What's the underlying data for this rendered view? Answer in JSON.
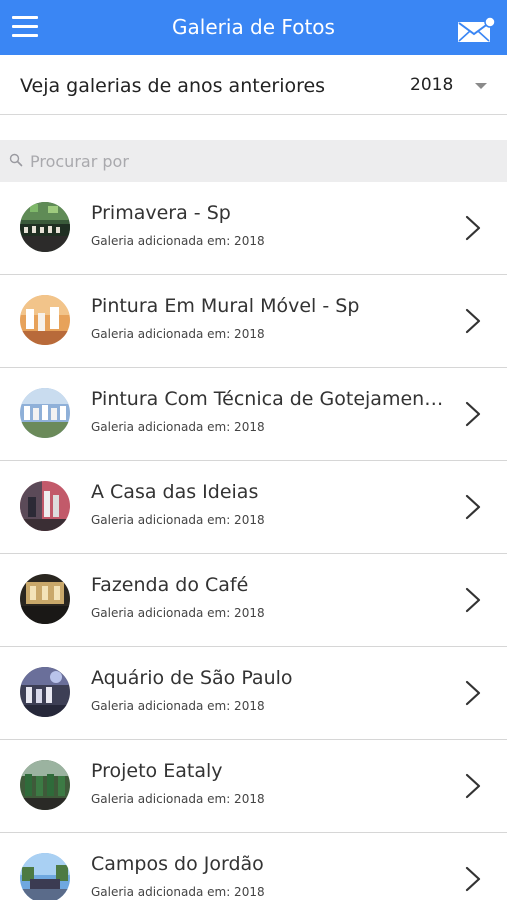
{
  "header": {
    "title": "Galeria de Fotos",
    "menu_icon": "hamburger-menu-icon",
    "mail_icon": "mail-notification-icon",
    "bg_color": "#3a86f4"
  },
  "year_selector": {
    "label": "Veja galerias de anos anteriores",
    "value": "2018",
    "caret_icon": "caret-down-icon"
  },
  "search": {
    "placeholder": "Procurar por",
    "icon": "search-icon"
  },
  "galleries": [
    {
      "title": "Primavera - Sp",
      "subtitle": "Galeria adicionada em: 2018"
    },
    {
      "title": "Pintura Em Mural Móvel - Sp",
      "subtitle": "Galeria adicionada em: 2018"
    },
    {
      "title": "Pintura Com Técnica de Gotejamento…",
      "subtitle": "Galeria adicionada em: 2018"
    },
    {
      "title": "A Casa das Ideias",
      "subtitle": "Galeria adicionada em: 2018"
    },
    {
      "title": "Fazenda do Café",
      "subtitle": "Galeria adicionada em: 2018"
    },
    {
      "title": "Aquário de São Paulo",
      "subtitle": "Galeria adicionada em: 2018"
    },
    {
      "title": "Projeto Eataly",
      "subtitle": "Galeria adicionada em: 2018"
    },
    {
      "title": "Campos do Jordão",
      "subtitle": "Galeria adicionada em: 2018"
    }
  ]
}
